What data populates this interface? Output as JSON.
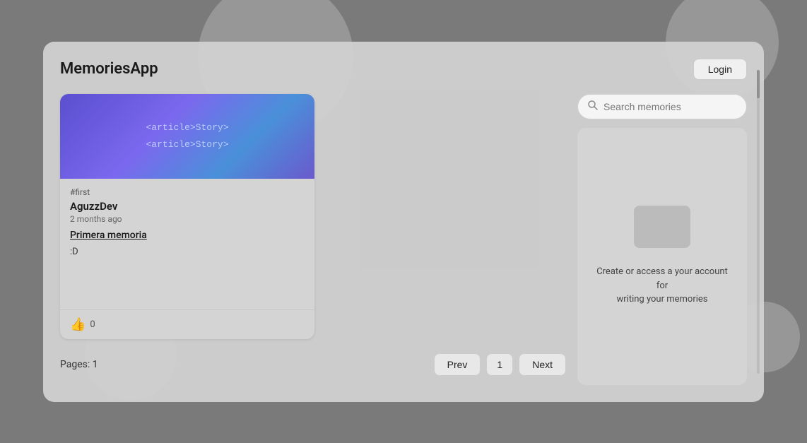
{
  "app": {
    "title": "MemoriesApp",
    "login_label": "Login"
  },
  "search": {
    "placeholder": "Search memories",
    "value": ""
  },
  "memory_card": {
    "tag": "#first",
    "author": "AguzzDev",
    "time": "2 months ago",
    "title": "Primera memoria",
    "description": ":D",
    "likes": "0",
    "image_lines": [
      "<article>Story>",
      "<article>Story>"
    ]
  },
  "pagination": {
    "pages_label": "Pages: 1",
    "prev_label": "Prev",
    "current_page": "1",
    "next_label": "Next"
  },
  "account_panel": {
    "message_line1": "Create or access a your account for",
    "message_line2": "writing your memories"
  }
}
